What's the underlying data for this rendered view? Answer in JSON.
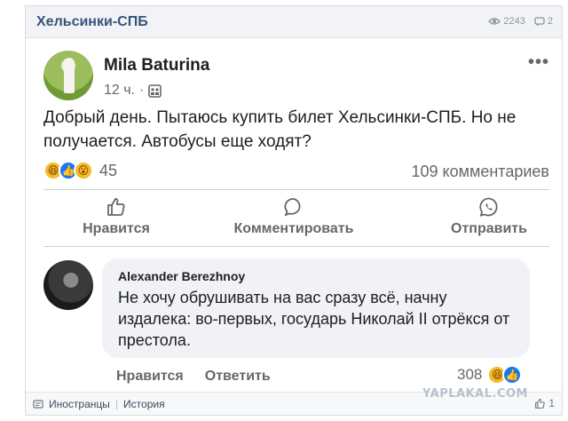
{
  "topic": {
    "title": "Хельсинки-СПБ",
    "views": "2243",
    "comments": "2"
  },
  "post": {
    "author": "Mila Baturina",
    "time": "12 ч.",
    "text": "Добрый день. Пытаюсь купить билет Хельсинки-СПБ. Но не получается. Автобусы еще ходят?",
    "reactions_count": "45",
    "comments_count": "109 комментариев",
    "actions": {
      "like": "Нравится",
      "comment": "Комментировать",
      "share": "Отправить"
    }
  },
  "comment": {
    "author": "Alexander Berezhnoy",
    "text": "Не хочу обрушивать на вас сразу всё, начну издалека: во-первых, государь Николай II отрёкся от престола.",
    "like_label": "Нравится",
    "reply_label": "Ответить",
    "reactions_count": "308"
  },
  "footer": {
    "tag1": "Иностранцы",
    "tag2": "История",
    "likes": "1"
  },
  "watermark": "YAPLAKAL.COM",
  "colors": {
    "title": "#38527a",
    "like_blue": "#1877f2",
    "haha_yellow": "#f7b928",
    "muted": "#65676b"
  },
  "icons": [
    "eye-icon",
    "comment-icon",
    "more-icon",
    "audience-icon",
    "haha-icon",
    "like-icon",
    "wow-icon",
    "thumb-icon",
    "speech-bubble-icon",
    "messenger-icon",
    "tag-icon"
  ]
}
